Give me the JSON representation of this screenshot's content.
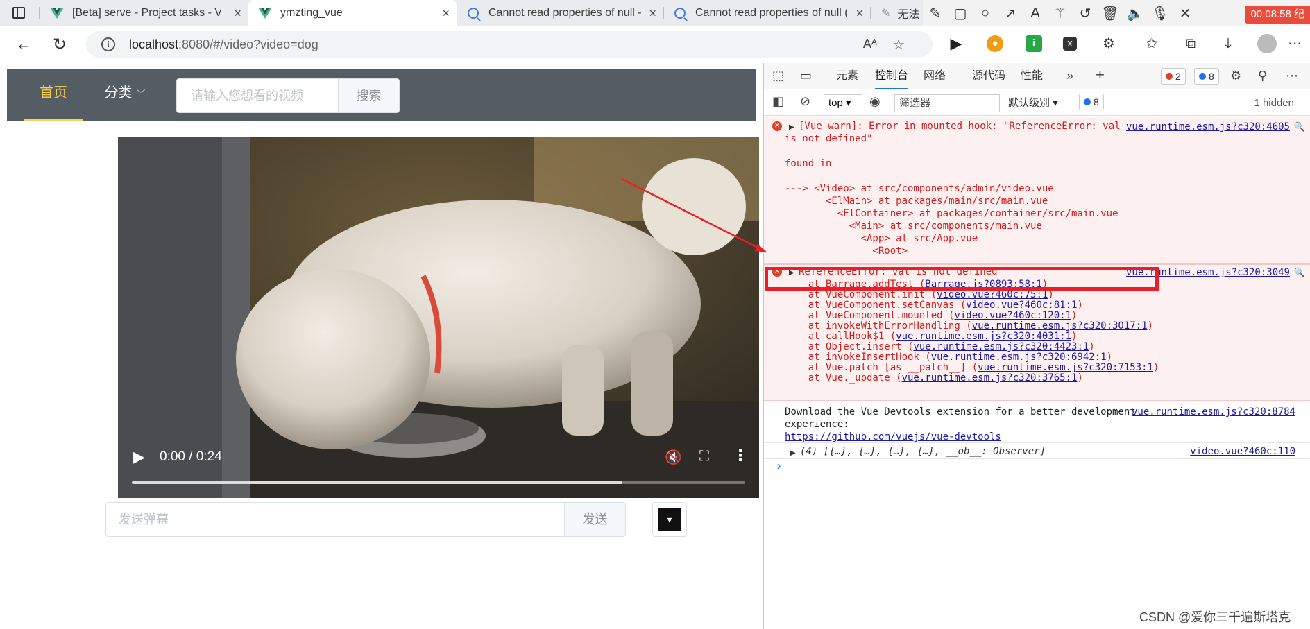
{
  "browser": {
    "tabs": [
      {
        "label": "[Beta] serve - Project tasks - Vue",
        "close": "×"
      },
      {
        "label": "ymzting_vue",
        "close": "×"
      },
      {
        "label": "Cannot read properties of null - j",
        "close": "×"
      },
      {
        "label": "Cannot read properties of null (re",
        "close": "×"
      },
      {
        "label": "无法"
      }
    ],
    "url_host": "localhost",
    "url_rest": ":8080/#/video?video=dog",
    "recording_time": "00:08:58 纪"
  },
  "site": {
    "nav_home": "首页",
    "nav_category": "分类",
    "search_placeholder": "请输入您想看的视频",
    "search_button": "搜索",
    "video_time": "0:00 / 0:24",
    "video_progress_fraction": 0.8,
    "danmu_placeholder": "发送弹幕",
    "danmu_send": "发送"
  },
  "devtools": {
    "tabs": {
      "elements": "元素",
      "console": "控制台",
      "network": "网络",
      "sources": "源代码",
      "performance": "性能"
    },
    "error_count": "2",
    "msg_count": "8",
    "context": "top",
    "filter_placeholder": "筛选器",
    "level": "默认级别",
    "level_badge": "8",
    "hidden": "1 hidden",
    "warn": {
      "lines": [
        "[Vue warn]: Error in mounted hook: \"ReferenceError: val",
        "is not defined\"",
        "",
        "found in",
        "",
        "---> <Video> at src/components/admin/video.vue",
        "       <ElMain> at packages/main/src/main.vue",
        "         <ElContainer> at packages/container/src/main.vue",
        "           <Main> at src/components/main.vue",
        "             <App> at src/App.vue",
        "               <Root>"
      ],
      "source": "vue.runtime.esm.js?c320:4605"
    },
    "error": {
      "title": "ReferenceError: val is not defined",
      "source": "vue.runtime.esm.js?c320:3049",
      "stack": [
        {
          "at": "    at Barrage.addTest (",
          "link": "Barrage.js?0893:58:1",
          "end": ")"
        },
        {
          "at": "    at VueComponent.init (",
          "link": "video.vue?460c:75:1",
          "end": ")"
        },
        {
          "at": "    at VueComponent.setCanvas (",
          "link": "video.vue?460c:81:1",
          "end": ")"
        },
        {
          "at": "    at VueComponent.mounted (",
          "link": "video.vue?460c:120:1",
          "end": ")"
        },
        {
          "at": "    at invokeWithErrorHandling (",
          "link": "vue.runtime.esm.js?c320:3017:1",
          "end": ")"
        },
        {
          "at": "    at callHook$1 (",
          "link": "vue.runtime.esm.js?c320:4031:1",
          "end": ")"
        },
        {
          "at": "    at Object.insert (",
          "link": "vue.runtime.esm.js?c320:4423:1",
          "end": ")"
        },
        {
          "at": "    at invokeInsertHook (",
          "link": "vue.runtime.esm.js?c320:6942:1",
          "end": ")"
        },
        {
          "at": "    at Vue.patch [as __patch__] (",
          "link": "vue.runtime.esm.js?c320:7153:1",
          "end": ")"
        },
        {
          "at": "    at Vue._update (",
          "link": "vue.runtime.esm.js?c320:3765:1",
          "end": ")"
        }
      ]
    },
    "info": {
      "line1": "Download the Vue Devtools extension for a better development",
      "line2": "experience:",
      "link": "https://github.com/vuejs/vue-devtools",
      "source": "vue.runtime.esm.js?c320:8784"
    },
    "log": {
      "text": "(4) [{…}, {…}, {…}, {…}, __ob__: Observer]",
      "source": "video.vue?460c:110"
    },
    "prompt": "›"
  },
  "watermark": "CSDN @爱你三千遍斯塔克"
}
